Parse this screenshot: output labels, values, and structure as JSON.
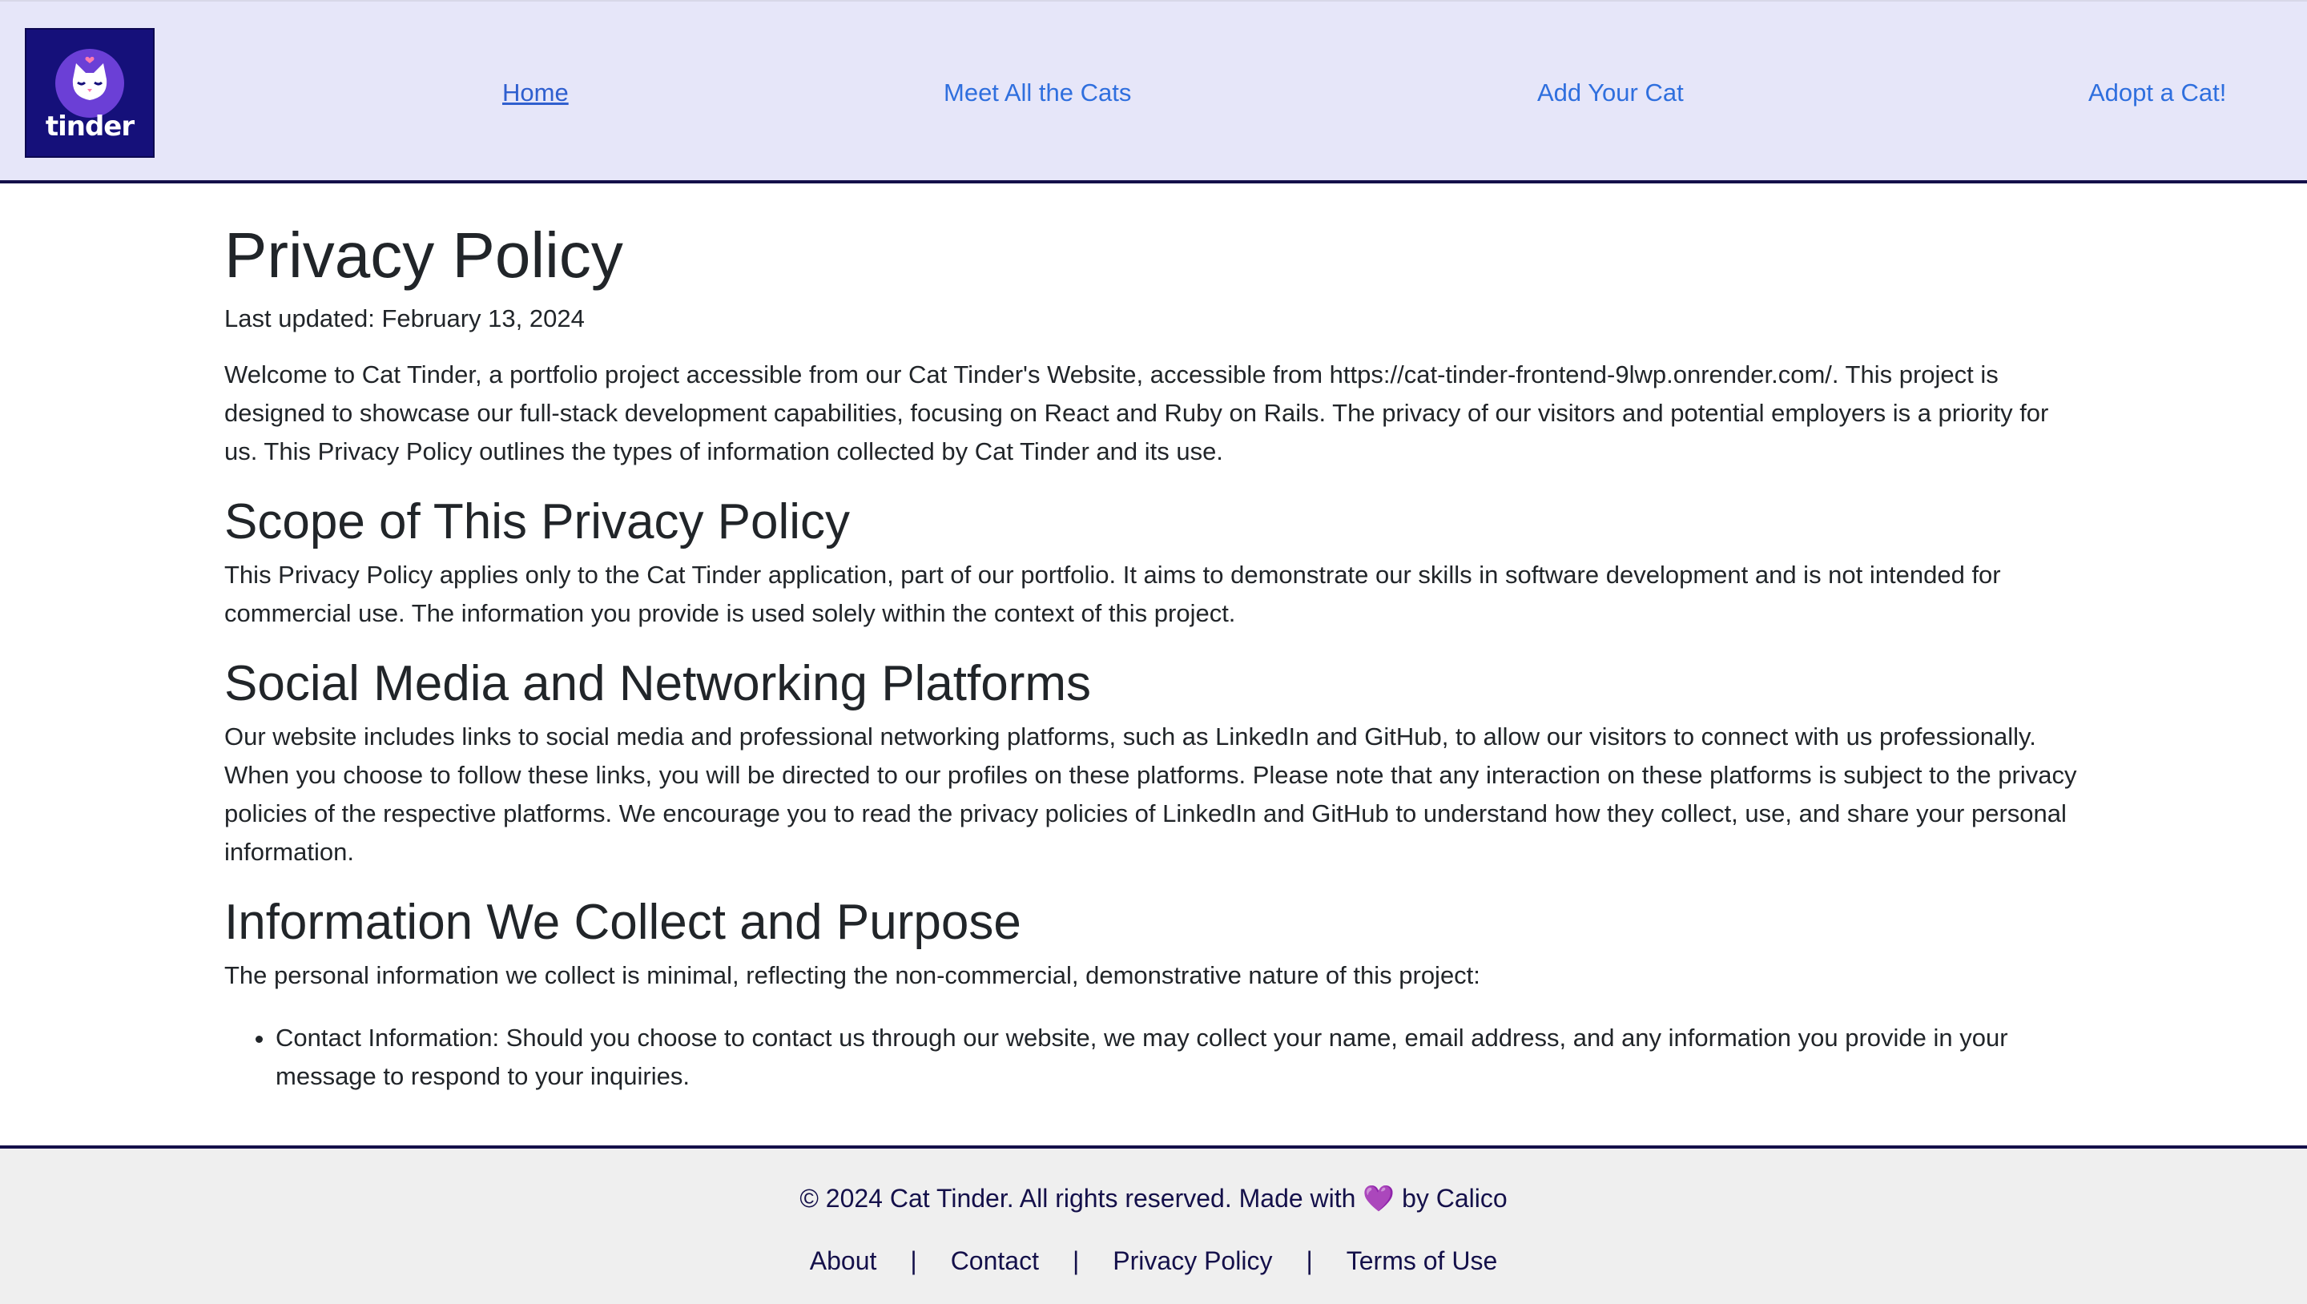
{
  "nav": {
    "logo_text": "tinder",
    "links": [
      {
        "label": "Home",
        "active": true
      },
      {
        "label": "Meet All the Cats",
        "active": false
      },
      {
        "label": "Add Your Cat",
        "active": false
      },
      {
        "label": "Adopt a Cat!",
        "active": false
      }
    ]
  },
  "page": {
    "title": "Privacy Policy",
    "last_updated": "Last updated: February 13, 2024",
    "intro": "Welcome to Cat Tinder, a portfolio project accessible from our Cat Tinder's Website, accessible from https://cat-tinder-frontend-9lwp.onrender.com/. This project is designed to showcase our full-stack development capabilities, focusing on React and Ruby on Rails. The privacy of our visitors and potential employers is a priority for us. This Privacy Policy outlines the types of information collected by Cat Tinder and its use.",
    "sections": [
      {
        "heading": "Scope of This Privacy Policy",
        "body": "This Privacy Policy applies only to the Cat Tinder application, part of our portfolio. It aims to demonstrate our skills in software development and is not intended for commercial use. The information you provide is used solely within the context of this project."
      },
      {
        "heading": "Social Media and Networking Platforms",
        "body": "Our website includes links to social media and professional networking platforms, such as LinkedIn and GitHub, to allow our visitors to connect with us professionally. When you choose to follow these links, you will be directed to our profiles on these platforms. Please note that any interaction on these platforms is subject to the privacy policies of the respective platforms. We encourage you to read the privacy policies of LinkedIn and GitHub to understand how they collect, use, and share your personal information."
      },
      {
        "heading": "Information We Collect and Purpose",
        "body": "The personal information we collect is minimal, reflecting the non-commercial, demonstrative nature of this project:",
        "list": [
          "Contact Information: Should you choose to contact us through our website, we may collect your name, email address, and any information you provide in your message to respond to your inquiries."
        ]
      }
    ]
  },
  "footer": {
    "copyright_prefix": "© 2024 Cat Tinder. All rights reserved. Made with ",
    "heart": "💜",
    "copyright_suffix": " by Calico",
    "links": [
      "About",
      "Contact",
      "Privacy Policy",
      "Terms of Use"
    ],
    "separator": "|"
  },
  "colors": {
    "nav_bg": "#e6e6f9",
    "nav_link": "#2f6fde",
    "brand_dark": "#14104a",
    "logo_bg": "#15107a",
    "footer_bg": "#efefef",
    "heart": "#9b3fe0"
  }
}
